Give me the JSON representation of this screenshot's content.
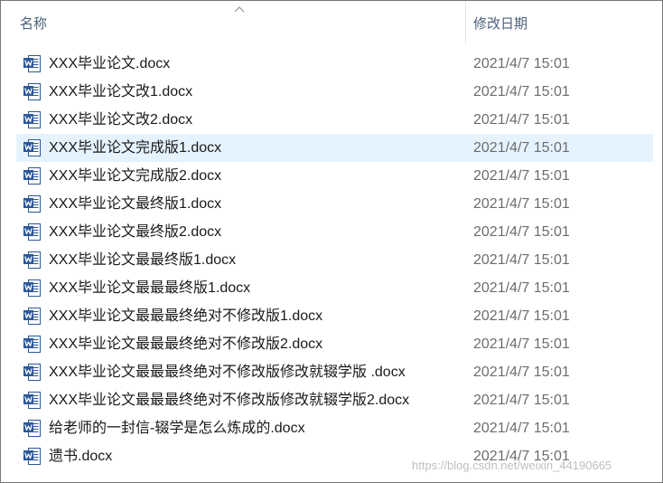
{
  "header": {
    "name_column": "名称",
    "date_column": "修改日期",
    "sort_icon": "chevron-up-icon"
  },
  "file_icon": "word-document-icon",
  "colors": {
    "hover_row": "#e5f3ff",
    "word_blue": "#2b579a",
    "header_text": "#4c607a",
    "date_text": "#6d6d6d"
  },
  "files": [
    {
      "name": "XXX毕业论文.docx",
      "date": "2021/4/7 15:01"
    },
    {
      "name": "XXX毕业论文改1.docx",
      "date": "2021/4/7 15:01"
    },
    {
      "name": "XXX毕业论文改2.docx",
      "date": "2021/4/7 15:01"
    },
    {
      "name": "XXX毕业论文完成版1.docx",
      "date": "2021/4/7 15:01",
      "hovered": true
    },
    {
      "name": "XXX毕业论文完成版2.docx",
      "date": "2021/4/7 15:01"
    },
    {
      "name": "XXX毕业论文最终版1.docx",
      "date": "2021/4/7 15:01"
    },
    {
      "name": "XXX毕业论文最终版2.docx",
      "date": "2021/4/7 15:01"
    },
    {
      "name": "XXX毕业论文最最终版1.docx",
      "date": "2021/4/7 15:01"
    },
    {
      "name": "XXX毕业论文最最最终版1.docx",
      "date": "2021/4/7 15:01"
    },
    {
      "name": "XXX毕业论文最最最终绝对不修改版1.docx",
      "date": "2021/4/7 15:01"
    },
    {
      "name": "XXX毕业论文最最最终绝对不修改版2.docx",
      "date": "2021/4/7 15:01"
    },
    {
      "name": "XXX毕业论文最最最终绝对不修改版修改就辍学版 .docx",
      "date": "2021/4/7 15:01"
    },
    {
      "name": "XXX毕业论文最最最终绝对不修改版修改就辍学版2.docx",
      "date": "2021/4/7 15:01"
    },
    {
      "name": "给老师的一封信-辍学是怎么炼成的.docx",
      "date": "2021/4/7 15:01"
    },
    {
      "name": "遗书.docx",
      "date": "2021/4/7 15:01"
    }
  ],
  "watermark": "https://blog.csdn.net/weixin_44190665"
}
